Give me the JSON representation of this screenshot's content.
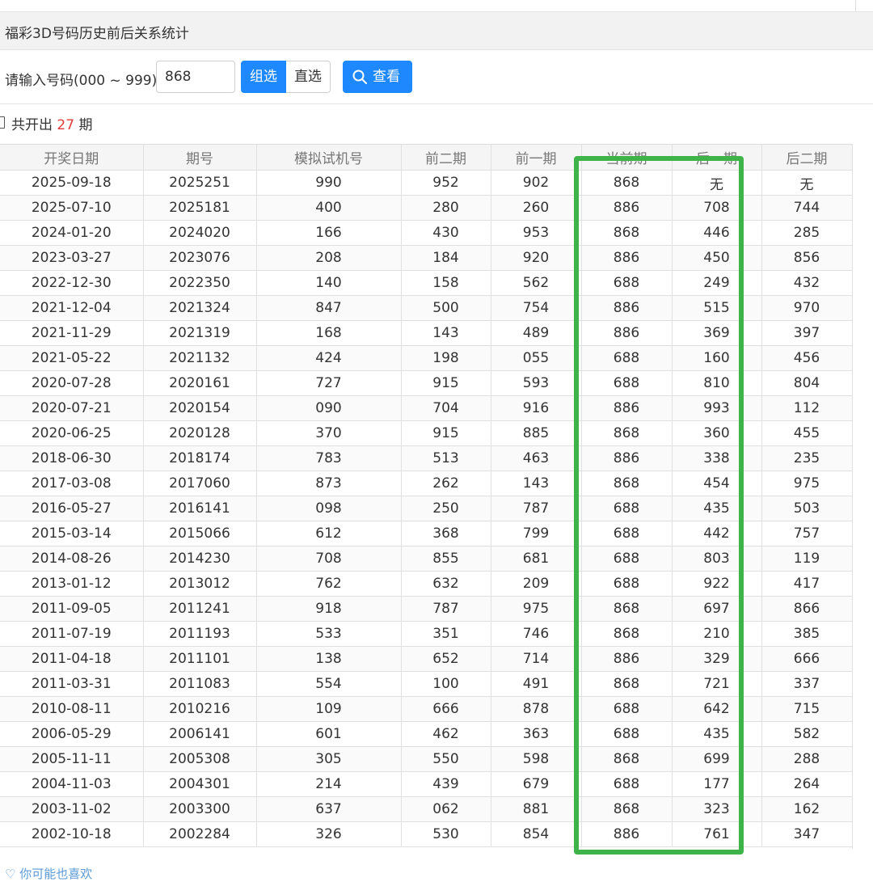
{
  "page": {
    "title": "福彩3D号码历史前后关系统计"
  },
  "search": {
    "label": "请输入号码(000 ~ 999)：",
    "value": "868",
    "mode_group": "组选",
    "mode_direct": "直选",
    "view_label": "查看"
  },
  "result": {
    "prefix": "共开出",
    "count": "27",
    "suffix": "期"
  },
  "table": {
    "headers": [
      "开奖日期",
      "期号",
      "模拟试机号",
      "前二期",
      "前一期",
      "当前期",
      "后一期",
      "后二期"
    ],
    "rows": [
      [
        "2025-09-18",
        "2025251",
        "990",
        "952",
        "902",
        "868",
        "无",
        "无"
      ],
      [
        "2025-07-10",
        "2025181",
        "400",
        "280",
        "260",
        "886",
        "708",
        "744"
      ],
      [
        "2024-01-20",
        "2024020",
        "166",
        "430",
        "953",
        "868",
        "446",
        "285"
      ],
      [
        "2023-03-27",
        "2023076",
        "208",
        "184",
        "920",
        "886",
        "450",
        "856"
      ],
      [
        "2022-12-30",
        "2022350",
        "140",
        "158",
        "562",
        "688",
        "249",
        "432"
      ],
      [
        "2021-12-04",
        "2021324",
        "847",
        "500",
        "754",
        "886",
        "515",
        "970"
      ],
      [
        "2021-11-29",
        "2021319",
        "168",
        "143",
        "489",
        "886",
        "369",
        "397"
      ],
      [
        "2021-05-22",
        "2021132",
        "424",
        "198",
        "055",
        "688",
        "160",
        "456"
      ],
      [
        "2020-07-28",
        "2020161",
        "727",
        "915",
        "593",
        "688",
        "810",
        "804"
      ],
      [
        "2020-07-21",
        "2020154",
        "090",
        "704",
        "916",
        "886",
        "993",
        "112"
      ],
      [
        "2020-06-25",
        "2020128",
        "370",
        "915",
        "885",
        "868",
        "360",
        "455"
      ],
      [
        "2018-06-30",
        "2018174",
        "783",
        "513",
        "463",
        "886",
        "338",
        "235"
      ],
      [
        "2017-03-08",
        "2017060",
        "873",
        "262",
        "143",
        "868",
        "454",
        "975"
      ],
      [
        "2016-05-27",
        "2016141",
        "098",
        "250",
        "787",
        "688",
        "435",
        "503"
      ],
      [
        "2015-03-14",
        "2015066",
        "612",
        "368",
        "799",
        "688",
        "442",
        "757"
      ],
      [
        "2014-08-26",
        "2014230",
        "708",
        "855",
        "681",
        "688",
        "803",
        "119"
      ],
      [
        "2013-01-12",
        "2013012",
        "762",
        "632",
        "209",
        "688",
        "922",
        "417"
      ],
      [
        "2011-09-05",
        "2011241",
        "918",
        "787",
        "975",
        "868",
        "697",
        "866"
      ],
      [
        "2011-07-19",
        "2011193",
        "533",
        "351",
        "746",
        "868",
        "210",
        "385"
      ],
      [
        "2011-04-18",
        "2011101",
        "138",
        "652",
        "714",
        "886",
        "329",
        "666"
      ],
      [
        "2011-03-31",
        "2011083",
        "554",
        "100",
        "491",
        "868",
        "721",
        "337"
      ],
      [
        "2010-08-11",
        "2010216",
        "109",
        "666",
        "878",
        "688",
        "642",
        "715"
      ],
      [
        "2006-05-29",
        "2006141",
        "601",
        "462",
        "363",
        "688",
        "435",
        "582"
      ],
      [
        "2005-11-11",
        "2005308",
        "305",
        "550",
        "598",
        "868",
        "699",
        "288"
      ],
      [
        "2004-11-03",
        "2004301",
        "214",
        "439",
        "679",
        "688",
        "177",
        "264"
      ],
      [
        "2003-11-02",
        "2003300",
        "637",
        "062",
        "881",
        "868",
        "323",
        "162"
      ],
      [
        "2002-10-18",
        "2002284",
        "326",
        "530",
        "854",
        "886",
        "761",
        "347"
      ]
    ]
  },
  "footer": {
    "text": "你可能也喜欢"
  },
  "colors": {
    "primary": "#1e88ff",
    "count_red": "#e03b3b",
    "highlight_green": "#3db34a"
  }
}
